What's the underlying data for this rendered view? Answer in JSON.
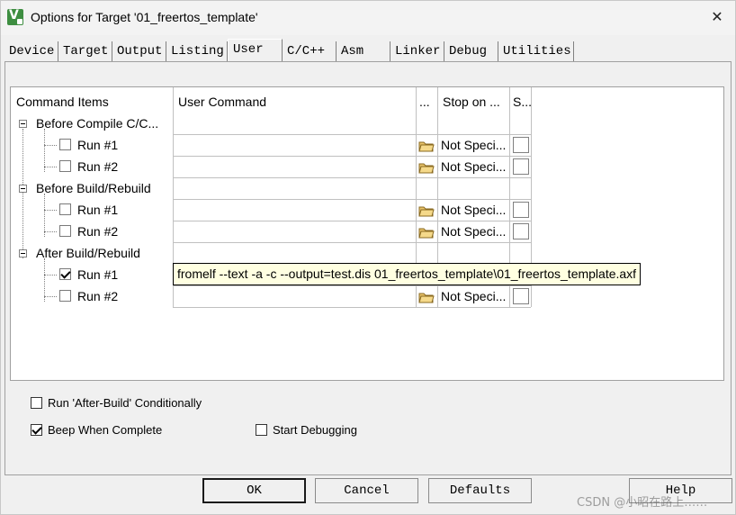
{
  "window": {
    "title": "Options for Target '01_freertos_template'",
    "app_icon": "keil-uvision-icon"
  },
  "tabs": [
    "Device",
    "Target",
    "Output",
    "Listing",
    "User",
    "C/C++",
    "Asm",
    "Linker",
    "Debug",
    "Utilities"
  ],
  "active_tab": "User",
  "grid": {
    "headers": [
      "Command Items",
      "User Command",
      "...",
      "Stop on ...",
      "S..."
    ],
    "groups": [
      {
        "label": "Before Compile C/C...",
        "runs": [
          {
            "label": "Run #1",
            "checked": false,
            "command": "",
            "stop_on": "Not Speci..."
          },
          {
            "label": "Run #2",
            "checked": false,
            "command": "",
            "stop_on": "Not Speci..."
          }
        ]
      },
      {
        "label": "Before Build/Rebuild",
        "runs": [
          {
            "label": "Run #1",
            "checked": false,
            "command": "",
            "stop_on": "Not Speci..."
          },
          {
            "label": "Run #2",
            "checked": false,
            "command": "",
            "stop_on": "Not Speci..."
          }
        ]
      },
      {
        "label": "After Build/Rebuild",
        "runs": [
          {
            "label": "Run #1",
            "checked": true,
            "command": "fromelf --text -a -c  --output=test.dis  01_freertos_template\\01_freertos_template.axf",
            "stop_on": ""
          },
          {
            "label": "Run #2",
            "checked": false,
            "command": "",
            "stop_on": "Not Speci..."
          }
        ]
      }
    ]
  },
  "options": {
    "after_build_conditional": {
      "label": "Run 'After-Build' Conditionally",
      "checked": false
    },
    "beep_when_complete": {
      "label": "Beep When Complete",
      "checked": true
    },
    "start_debugging": {
      "label": "Start Debugging",
      "checked": false
    }
  },
  "buttons": {
    "ok": "OK",
    "cancel": "Cancel",
    "defaults": "Defaults",
    "help": "Help"
  },
  "watermark": "CSDN @小昭在路上……",
  "colors": {
    "tooltip_bg": "#ffffe1",
    "dialog_bg": "#f0f0f0"
  }
}
